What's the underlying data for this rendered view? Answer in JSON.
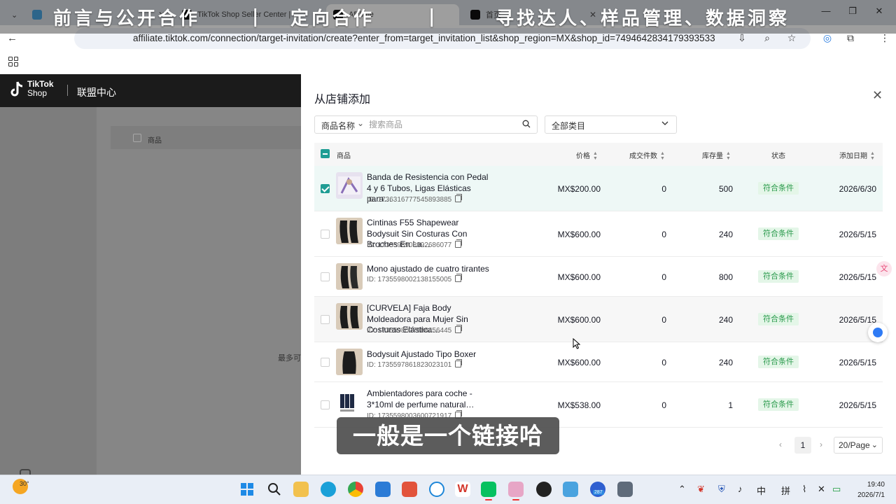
{
  "overlay_title": {
    "part1": "前言与公开合作",
    "sep": "|",
    "part2": "定向合作",
    "sep2": "|",
    "part3": "寻找达人、样品管理、数据洞察"
  },
  "browser": {
    "tabs": [
      {
        "label": "TikTok Shop Seller Center |"
      },
      {
        "label": "Affiliate"
      },
      {
        "label": "首页"
      }
    ],
    "url": "affiliate.tiktok.com/connection/target-invitation/create?enter_from=target_invitation_list&shop_region=MX&shop_id=7494642834179393533"
  },
  "tiktok_header": {
    "brand_line1": "TikTok",
    "brand_line2": "Shop",
    "center": "联盟中心"
  },
  "background_page": {
    "column_product": "商品",
    "note": "最多可"
  },
  "drawer": {
    "title": "从店铺添加",
    "search": {
      "type": "商品名称",
      "placeholder": "搜索商品"
    },
    "category": "全部类目",
    "columns": {
      "product": "商品",
      "price": "价格",
      "sold": "成交件数",
      "stock": "库存量",
      "status": "状态",
      "date": "添加日期"
    },
    "rows": [
      {
        "name": "Banda de Resistencia con Pedal 4 y 6 Tubos, Ligas Elásticas para…",
        "id": "ID: 1736316777545893885",
        "price": "MX$200.00",
        "sold": "0",
        "stock": "500",
        "status": "符合条件",
        "date": "2026/6/30",
        "selected": true
      },
      {
        "name": "Cintinas F55 Shapewear Bodysuit Sin Costuras Con Broches En La…",
        "id": "ID: 1735598908992686077",
        "price": "MX$600.00",
        "sold": "0",
        "stock": "240",
        "status": "符合条件",
        "date": "2026/5/15",
        "selected": false
      },
      {
        "name": "Mono ajustado de cuatro tirantes",
        "id": "ID: 1735598002138155005",
        "price": "MX$600.00",
        "sold": "0",
        "stock": "800",
        "status": "符合条件",
        "date": "2026/5/15",
        "selected": false
      },
      {
        "name": "[CURVELA] Faja Body Moldeadora para Mujer Sin Costuras Elástica…",
        "id": "ID: 1735598007588456445",
        "price": "MX$600.00",
        "sold": "0",
        "stock": "240",
        "status": "符合条件",
        "date": "2026/5/15",
        "selected": false
      },
      {
        "name": "Bodysuit Ajustado Tipo Boxer",
        "id": "ID: 1735597861823023101",
        "price": "MX$600.00",
        "sold": "0",
        "stock": "240",
        "status": "符合条件",
        "date": "2026/5/15",
        "selected": false
      },
      {
        "name": "Ambientadores para coche - 3*10ml de perfume natural…",
        "id": "ID: 1735598003600721917",
        "price": "MX$538.00",
        "sold": "0",
        "stock": "1",
        "status": "符合条件",
        "date": "2026/5/15",
        "selected": false
      }
    ],
    "pagination": {
      "current": "1",
      "page_size": "20/Page"
    }
  },
  "caption": "一般是一个链接哈",
  "taskbar": {
    "weather": "30°",
    "ime": "中",
    "ime2": "拼",
    "time": "19:40",
    "date": "2026/7/1",
    "badge": "287"
  },
  "colors": {
    "accent_teal": "#1f9d94",
    "status_green_bg": "#e4f6e8",
    "status_green_text": "#2a9a4c",
    "selected_row": "#eef8f6"
  }
}
